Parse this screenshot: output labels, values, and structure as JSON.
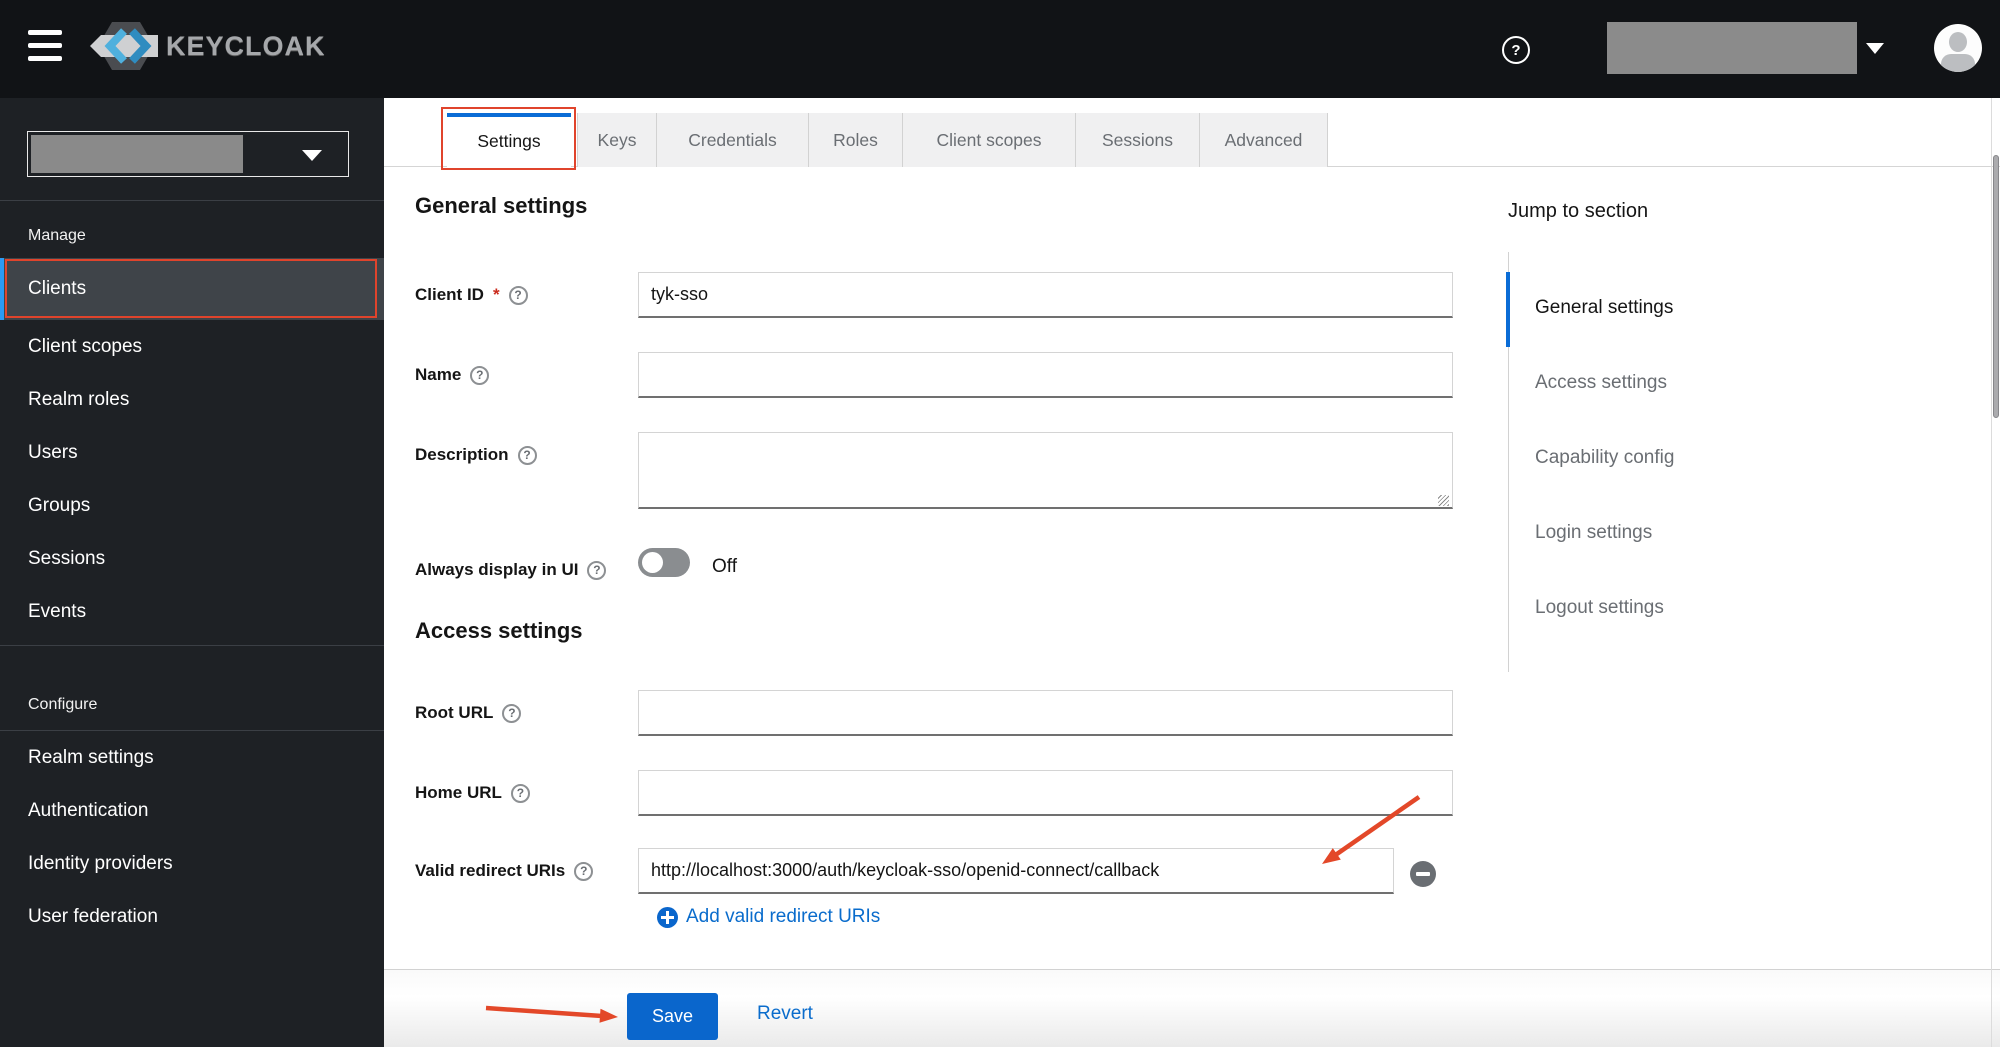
{
  "header": {
    "brand": "KEYCLOAK",
    "help_glyph": "?"
  },
  "sidebar": {
    "manage_label": "Manage",
    "manage_items": [
      {
        "label": "Clients",
        "active": true
      },
      {
        "label": "Client scopes"
      },
      {
        "label": "Realm roles"
      },
      {
        "label": "Users"
      },
      {
        "label": "Groups"
      },
      {
        "label": "Sessions"
      },
      {
        "label": "Events"
      }
    ],
    "configure_label": "Configure",
    "configure_items": [
      {
        "label": "Realm settings"
      },
      {
        "label": "Authentication"
      },
      {
        "label": "Identity providers"
      },
      {
        "label": "User federation"
      }
    ]
  },
  "tabs": [
    {
      "label": "Settings",
      "active": true
    },
    {
      "label": "Keys"
    },
    {
      "label": "Credentials"
    },
    {
      "label": "Roles"
    },
    {
      "label": "Client scopes"
    },
    {
      "label": "Sessions"
    },
    {
      "label": "Advanced"
    }
  ],
  "form": {
    "general_title": "General settings",
    "client_id_label": "Client ID",
    "required_marker": "*",
    "client_id_value": "tyk-sso",
    "name_label": "Name",
    "description_label": "Description",
    "always_display_label": "Always display in UI",
    "always_display_state": "Off",
    "access_title": "Access settings",
    "root_url_label": "Root URL",
    "home_url_label": "Home URL",
    "valid_redirect_label": "Valid redirect URIs",
    "valid_redirect_value": "http://localhost:3000/auth/keycloak-sso/openid-connect/callback",
    "add_redirect_label": "Add valid redirect URIs",
    "help_glyph": "?"
  },
  "jump": {
    "title": "Jump to section",
    "items": [
      {
        "label": "General settings",
        "active": true
      },
      {
        "label": "Access settings"
      },
      {
        "label": "Capability config"
      },
      {
        "label": "Login settings"
      },
      {
        "label": "Logout settings"
      }
    ]
  },
  "actions": {
    "save_label": "Save",
    "revert_label": "Revert"
  },
  "colors": {
    "accent_blue": "#0a66cc",
    "annotation_red": "#e0442c",
    "nav_active_bar": "#2b9af3",
    "tab_active_bar": "#0a6cd6",
    "masthead_bg": "#111316",
    "sidebar_bg": "#1e2125"
  }
}
